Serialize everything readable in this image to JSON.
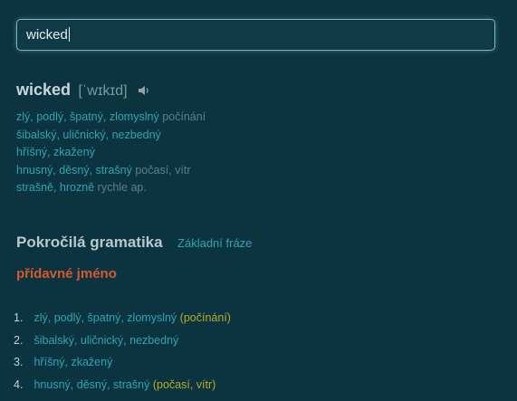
{
  "search": {
    "value": "wicked"
  },
  "entry": {
    "headword": "wicked",
    "pronunciation": "[ˈwɪkɪd]",
    "speaker_icon": "speaker-icon",
    "translations": [
      {
        "words": "zlý, podlý, špatný, zlomyslný",
        "context": "počínání"
      },
      {
        "words": "šibalský, uličnický, nezbedný",
        "context": ""
      },
      {
        "words": "hříšný, zkažený",
        "context": ""
      },
      {
        "words": "hnusný, děsný, strašný",
        "context": "počasí, vítr"
      },
      {
        "words": "strašně, hrozně",
        "context": "rychle ap."
      }
    ]
  },
  "grammar": {
    "title": "Pokročilá gramatika",
    "link": "Základní fráze",
    "part_of_speech": "přídavné jméno",
    "items": [
      {
        "num": "1.",
        "words": "zlý, podlý, špatný, zlomyslný",
        "context": "(počínání)"
      },
      {
        "num": "2.",
        "words": "šibalský, uličnický, nezbedný",
        "context": ""
      },
      {
        "num": "3.",
        "words": "hříšný, zkažený",
        "context": ""
      },
      {
        "num": "4.",
        "words": "hnusný, děsný, strašný",
        "context": "(počasí, vítr)"
      }
    ]
  },
  "colors": {
    "background": "#0c3340",
    "link_teal": "#2fa5b3",
    "context_gray": "#5e7f88",
    "pos_orange": "#d9582a",
    "context_yellow": "#b5ad2a"
  }
}
